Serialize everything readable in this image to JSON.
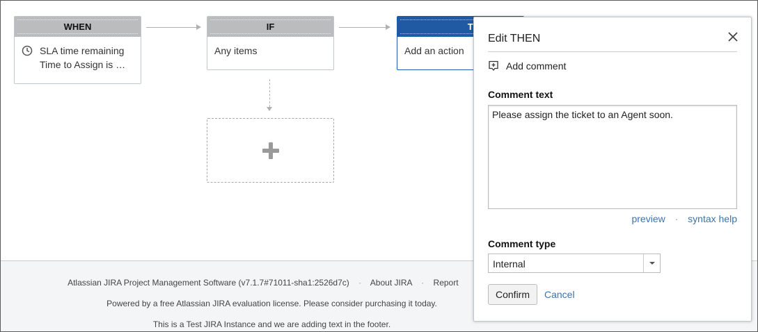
{
  "flow": {
    "when": {
      "header": "WHEN",
      "line1": "SLA time remaining",
      "line2": "Time to Assign is …"
    },
    "if": {
      "header": "IF",
      "text": "Any items"
    },
    "then": {
      "header": "THEN",
      "text": "Add an action"
    }
  },
  "panel": {
    "title": "Edit THEN",
    "action_name": "Add comment",
    "comment_text_label": "Comment text",
    "comment_text_value": "Please assign the ticket to an Agent soon.",
    "preview_link": "preview",
    "separator": "·",
    "syntax_help_link": "syntax help",
    "comment_type_label": "Comment type",
    "comment_type_value": "Internal",
    "confirm_label": "Confirm",
    "cancel_label": "Cancel"
  },
  "footer": {
    "software": "Atlassian JIRA Project Management Software (v7.1.7#71011-sha1:2526d7c)",
    "about": "About JIRA",
    "report": "Report",
    "separator": "·",
    "license": "Powered by a free Atlassian JIRA evaluation license. Please consider purchasing it today.",
    "custom": "This is a Test JIRA Instance and we are adding text in the footer."
  },
  "colors": {
    "then_header": "#1f5aa3",
    "link": "#3b73af",
    "header_gray": "#bbbcbd"
  },
  "icons": [
    "clock-icon",
    "plus-icon",
    "close-icon",
    "comment-icon",
    "chevron-down-icon"
  ]
}
